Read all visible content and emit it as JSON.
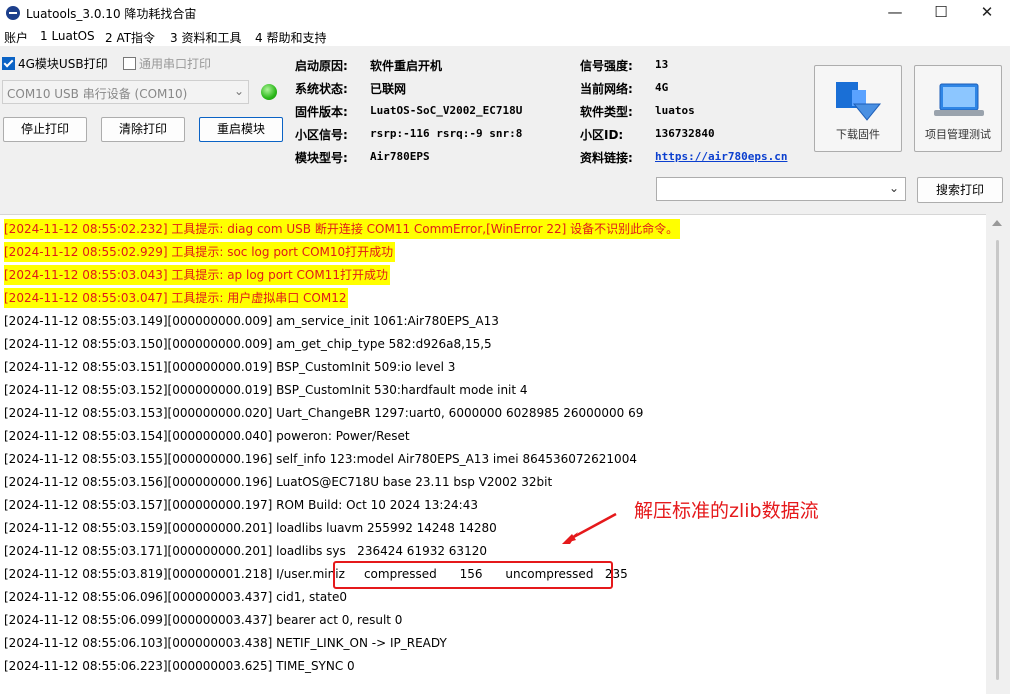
{
  "window": {
    "title": "Luatools_3.0.10 降功耗找合宙",
    "minimize": "—",
    "maximize": "☐",
    "close": "✕"
  },
  "menu": [
    "账户",
    "1 LuatOS",
    "2 AT指令",
    "3 资料和工具",
    "4 帮助和支持"
  ],
  "options": {
    "usb_print_label": "4G模块USB打印",
    "usb_print_checked": true,
    "serial_print_label": "通用串口打印",
    "serial_print_checked": false
  },
  "port": {
    "value": "COM10 USB 串行设备 (COM10)"
  },
  "buttons": {
    "stop_print": "停止打印",
    "clear_print": "清除打印",
    "restart_module": "重启模块",
    "search_print": "搜索打印"
  },
  "device_info": {
    "boot_reason_label": "启动原因:",
    "boot_reason": "软件重启开机",
    "system_status_label": "系统状态:",
    "system_status": "已联网",
    "firmware_label": "固件版本:",
    "firmware": "LuatOS-SoC_V2002_EC718U",
    "cell_signal_label": "小区信号:",
    "cell_signal": "rsrp:-116 rsrq:-9 snr:8",
    "module_label": "模块型号:",
    "module": "Air780EPS",
    "signal_strength_label": "信号强度:",
    "signal_strength": "13",
    "network_label": "当前网络:",
    "network": "4G",
    "software_type_label": "软件类型:",
    "software_type": "luatos",
    "cell_id_label": "小区ID:",
    "cell_id": "136732840",
    "docs_link_label": "资料链接:",
    "docs_link": "https://air780eps.cn"
  },
  "tools": {
    "download_firmware": "下载固件",
    "project_test": "项目管理测试"
  },
  "search": {
    "value": ""
  },
  "log": [
    {
      "text": "[2024-11-12 08:55:02.232] 工具提示: diag com USB 断开连接 COM11 CommError,[WinError 22] 设备不识别此命令。",
      "highlight": true
    },
    {
      "text": "[2024-11-12 08:55:02.929] 工具提示: soc log port COM10打开成功",
      "highlight": true
    },
    {
      "text": "[2024-11-12 08:55:03.043] 工具提示: ap log port COM11打开成功",
      "highlight": true
    },
    {
      "text": "[2024-11-12 08:55:03.047] 工具提示: 用户虚拟串口 COM12",
      "highlight": true
    },
    {
      "text": "[2024-11-12 08:55:03.149][000000000.009] am_service_init 1061:Air780EPS_A13",
      "highlight": false
    },
    {
      "text": "[2024-11-12 08:55:03.150][000000000.009] am_get_chip_type 582:d926a8,15,5",
      "highlight": false
    },
    {
      "text": "[2024-11-12 08:55:03.151][000000000.019] BSP_CustomInit 509:io level 3",
      "highlight": false
    },
    {
      "text": "[2024-11-12 08:55:03.152][000000000.019] BSP_CustomInit 530:hardfault mode init 4",
      "highlight": false
    },
    {
      "text": "[2024-11-12 08:55:03.153][000000000.020] Uart_ChangeBR 1297:uart0, 6000000 6028985 26000000 69",
      "highlight": false
    },
    {
      "text": "[2024-11-12 08:55:03.154][000000000.040] poweron: Power/Reset",
      "highlight": false
    },
    {
      "text": "[2024-11-12 08:55:03.155][000000000.196] self_info 123:model Air780EPS_A13 imei 864536072621004",
      "highlight": false
    },
    {
      "text": "[2024-11-12 08:55:03.156][000000000.196] LuatOS@EC718U base 23.11 bsp V2002 32bit",
      "highlight": false
    },
    {
      "text": "[2024-11-12 08:55:03.157][000000000.197] ROM Build: Oct 10 2024 13:24:43",
      "highlight": false
    },
    {
      "text": "[2024-11-12 08:55:03.159][000000000.201] loadlibs luavm 255992 14248 14280",
      "highlight": false
    },
    {
      "text": "[2024-11-12 08:55:03.171][000000000.201] loadlibs sys   236424 61932 63120",
      "highlight": false
    },
    {
      "text": "[2024-11-12 08:55:03.819][000000001.218] I/user.miniz     compressed      156      uncompressed   235",
      "highlight": false
    },
    {
      "text": "[2024-11-12 08:55:06.096][000000003.437] cid1, state0",
      "highlight": false
    },
    {
      "text": "[2024-11-12 08:55:06.099][000000003.437] bearer act 0, result 0",
      "highlight": false
    },
    {
      "text": "[2024-11-12 08:55:06.103][000000003.438] NETIF_LINK_ON -> IP_READY",
      "highlight": false
    },
    {
      "text": "[2024-11-12 08:55:06.223][000000003.625] TIME_SYNC 0",
      "highlight": false
    }
  ],
  "annotation": {
    "text": "解压标准的zlib数据流",
    "color": "#e5191b"
  },
  "colors": {
    "highlight_bg": "#ffff00",
    "highlight_text": "#e01a1a",
    "link": "#0b3fcf",
    "accent": "#0b63c5",
    "status_led": "#2bb81a"
  }
}
